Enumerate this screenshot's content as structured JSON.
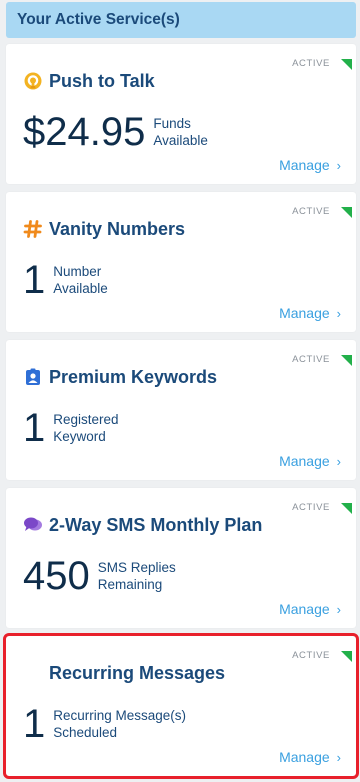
{
  "header": {
    "title": "Your Active Service(s)"
  },
  "cards": [
    {
      "title": "Push to Talk",
      "icon": "push-to-talk-icon",
      "status": "ACTIVE",
      "value": "$24.95",
      "label_line1": "Funds",
      "label_line2": "Available",
      "manage": "Manage"
    },
    {
      "title": "Vanity Numbers",
      "icon": "hash-icon",
      "status": "ACTIVE",
      "value": "1",
      "label_line1": "Number",
      "label_line2": "Available",
      "manage": "Manage"
    },
    {
      "title": "Premium Keywords",
      "icon": "contact-badge-icon",
      "status": "ACTIVE",
      "value": "1",
      "label_line1": "Registered",
      "label_line2": "Keyword",
      "manage": "Manage"
    },
    {
      "title": "2-Way SMS Monthly Plan",
      "icon": "chat-bubbles-icon",
      "status": "ACTIVE",
      "value": "450",
      "label_line1": "SMS Replies",
      "label_line2": "Remaining",
      "manage": "Manage"
    },
    {
      "title": "Recurring Messages",
      "icon": "",
      "status": "ACTIVE",
      "value": "1",
      "label_line1": "Recurring Message(s)",
      "label_line2": "Scheduled",
      "manage": "Manage",
      "highlighted": true
    }
  ],
  "colors": {
    "header_bg": "#a9d8f3",
    "title": "#1b4a7a",
    "link": "#3aa0e0",
    "active_flag": "#22b04a",
    "highlight": "#e8202b"
  }
}
